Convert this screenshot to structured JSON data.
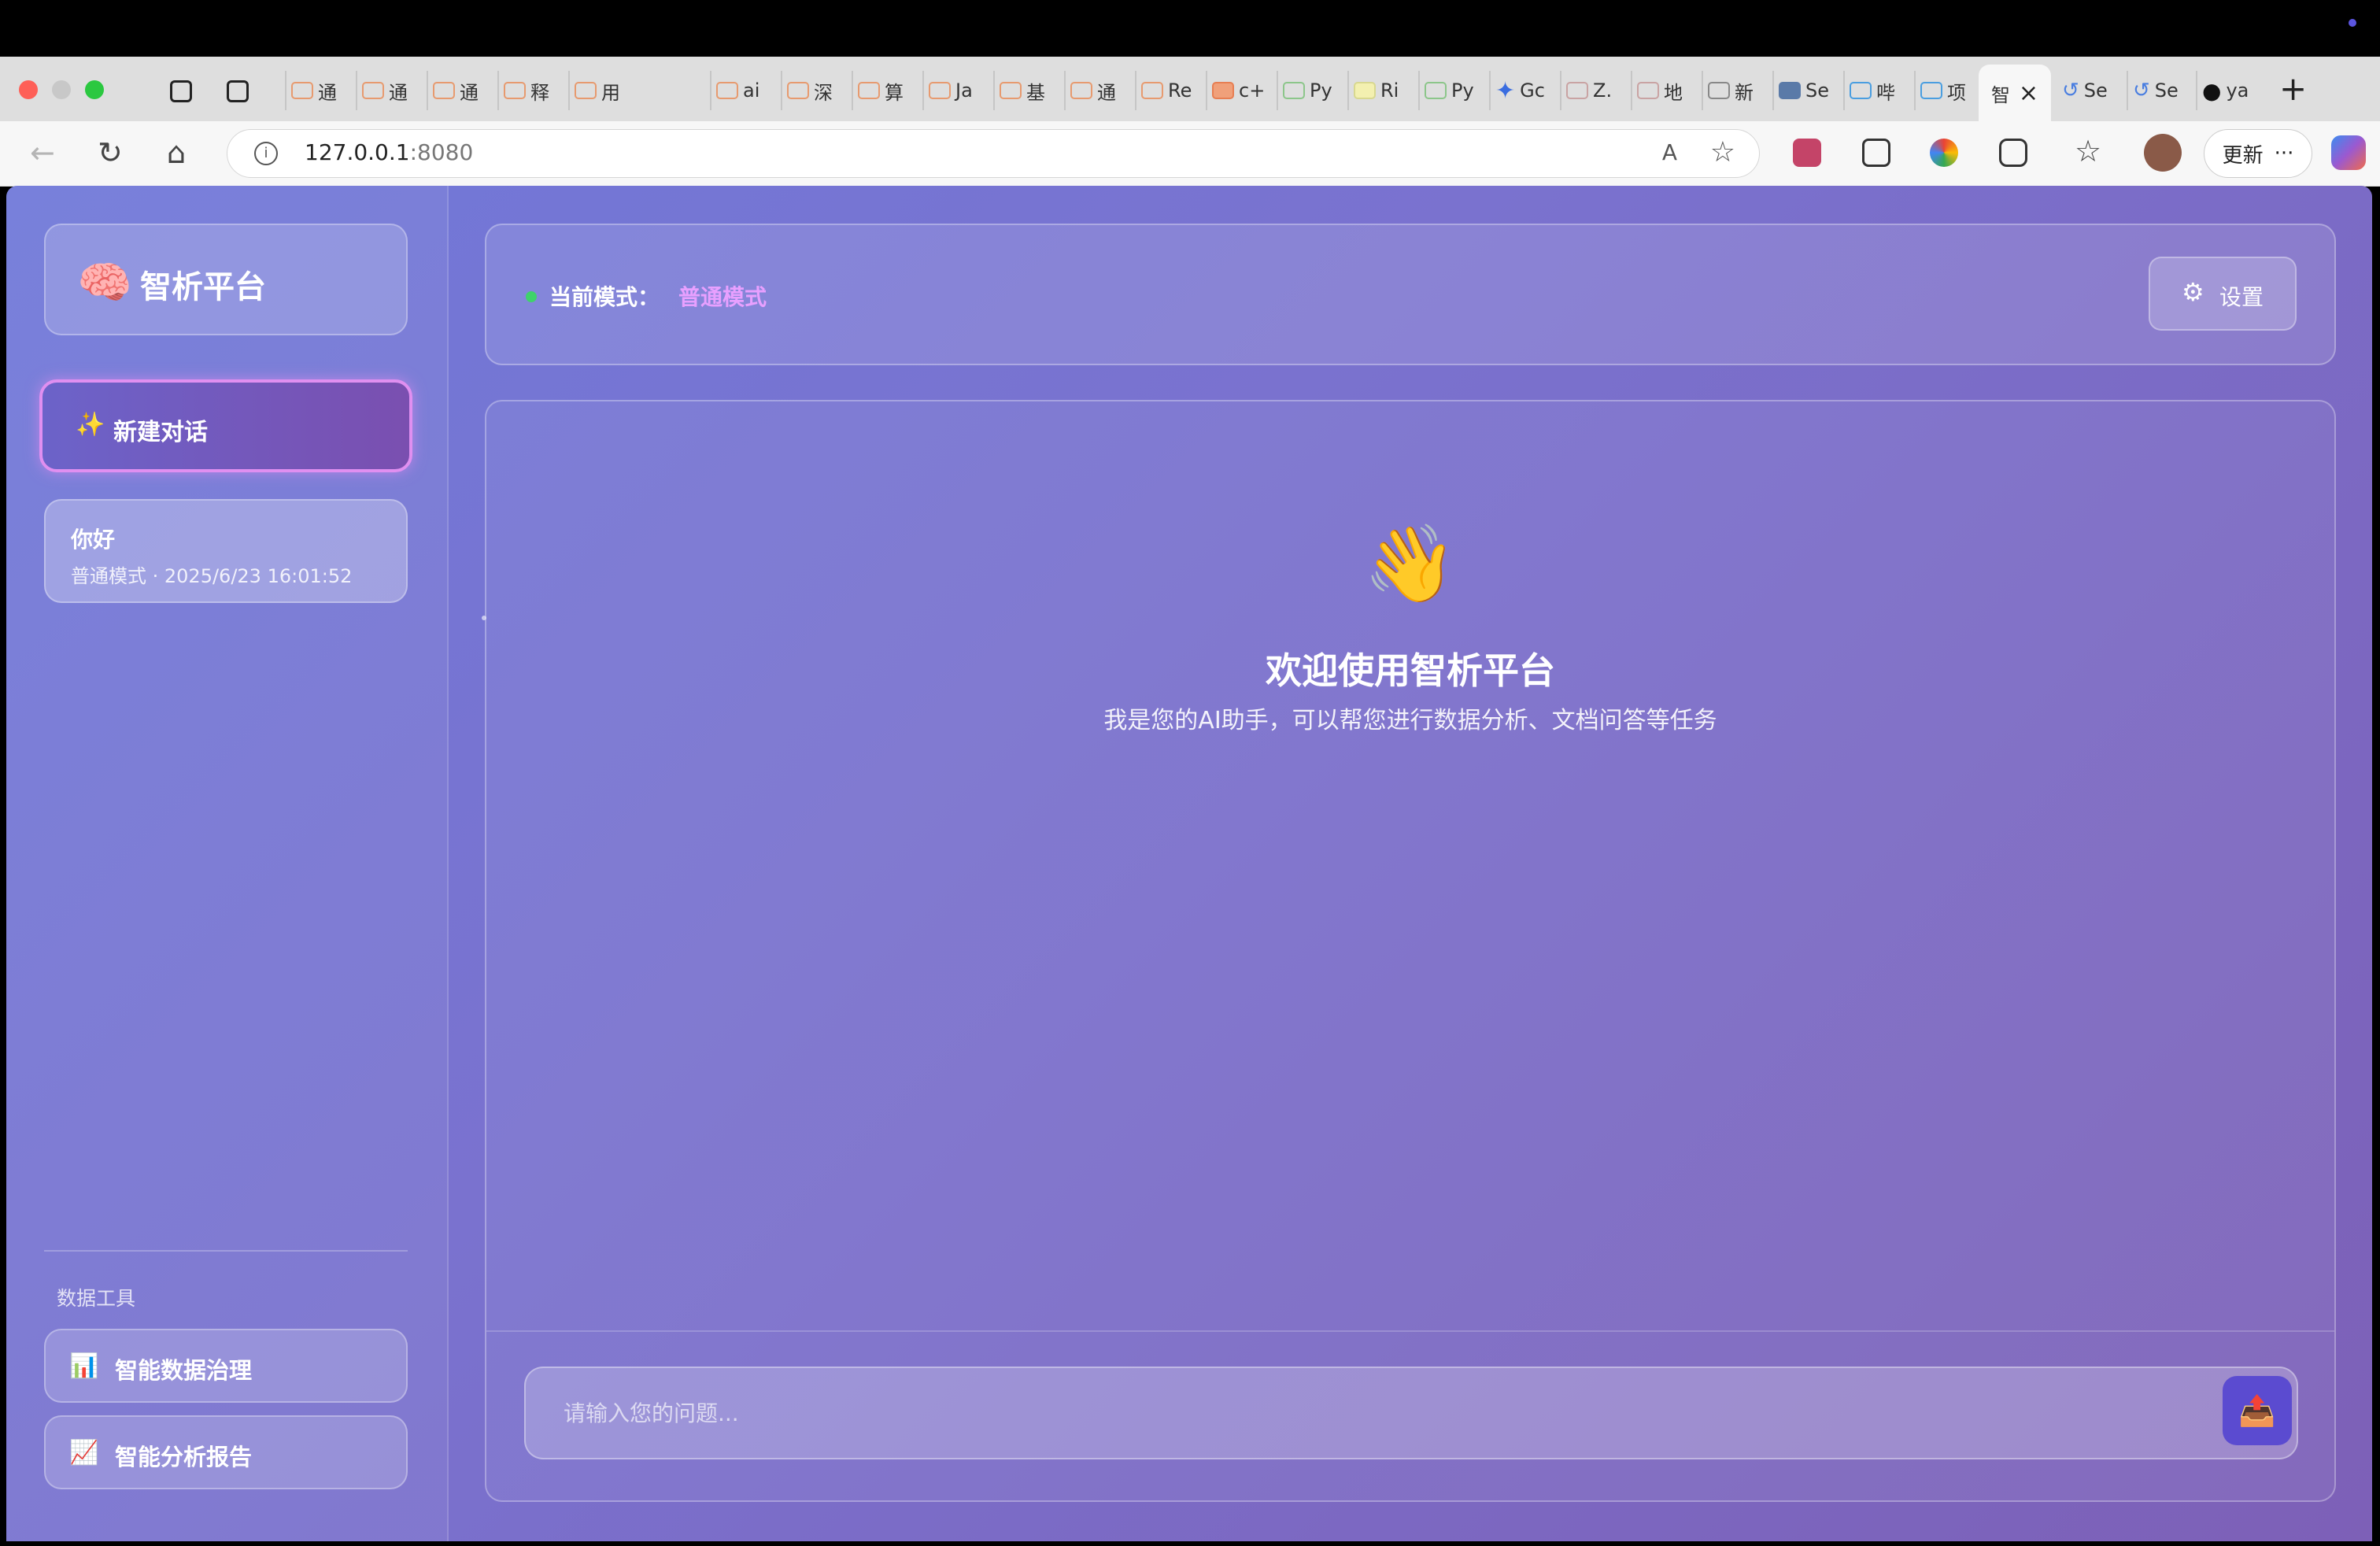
{
  "browser": {
    "tabs": [
      "通",
      "通",
      "通",
      "释",
      "用",
      "ai",
      "深",
      "算",
      "Ja",
      "基",
      "通",
      "Re",
      "c+",
      "Py",
      "Ri",
      "Py",
      "Gc",
      "Z.",
      "地",
      "新",
      "Se",
      "哔",
      "项",
      "智",
      "Se",
      "Se",
      "ya"
    ],
    "active_tab": "智",
    "url_host": "127.0.0.1",
    "url_port": ":8080",
    "read_aloud": "A",
    "update_label": "更新",
    "more_label": "···"
  },
  "sidebar": {
    "brand_emoji": "🧠",
    "brand_name": "智析平台",
    "new_chat_icon": "✨",
    "new_chat_label": "新建对话",
    "history": [
      {
        "title": "你好",
        "meta": "普通模式 · 2025/6/23 16:01:52"
      }
    ],
    "tools_title": "数据工具",
    "tools": [
      {
        "icon": "📊",
        "label": "智能数据治理"
      },
      {
        "icon": "📈",
        "label": "智能分析报告"
      }
    ]
  },
  "header": {
    "mode_label": "当前模式：",
    "mode_value": "普通模式",
    "settings_icon": "⚙",
    "settings_label": "设置"
  },
  "welcome": {
    "emoji": "👋",
    "title": "欢迎使用智析平台",
    "subtitle": "我是您的AI助手，可以帮您进行数据分析、文档问答等任务"
  },
  "input": {
    "placeholder": "请输入您的问题...",
    "send_icon": "📤"
  }
}
